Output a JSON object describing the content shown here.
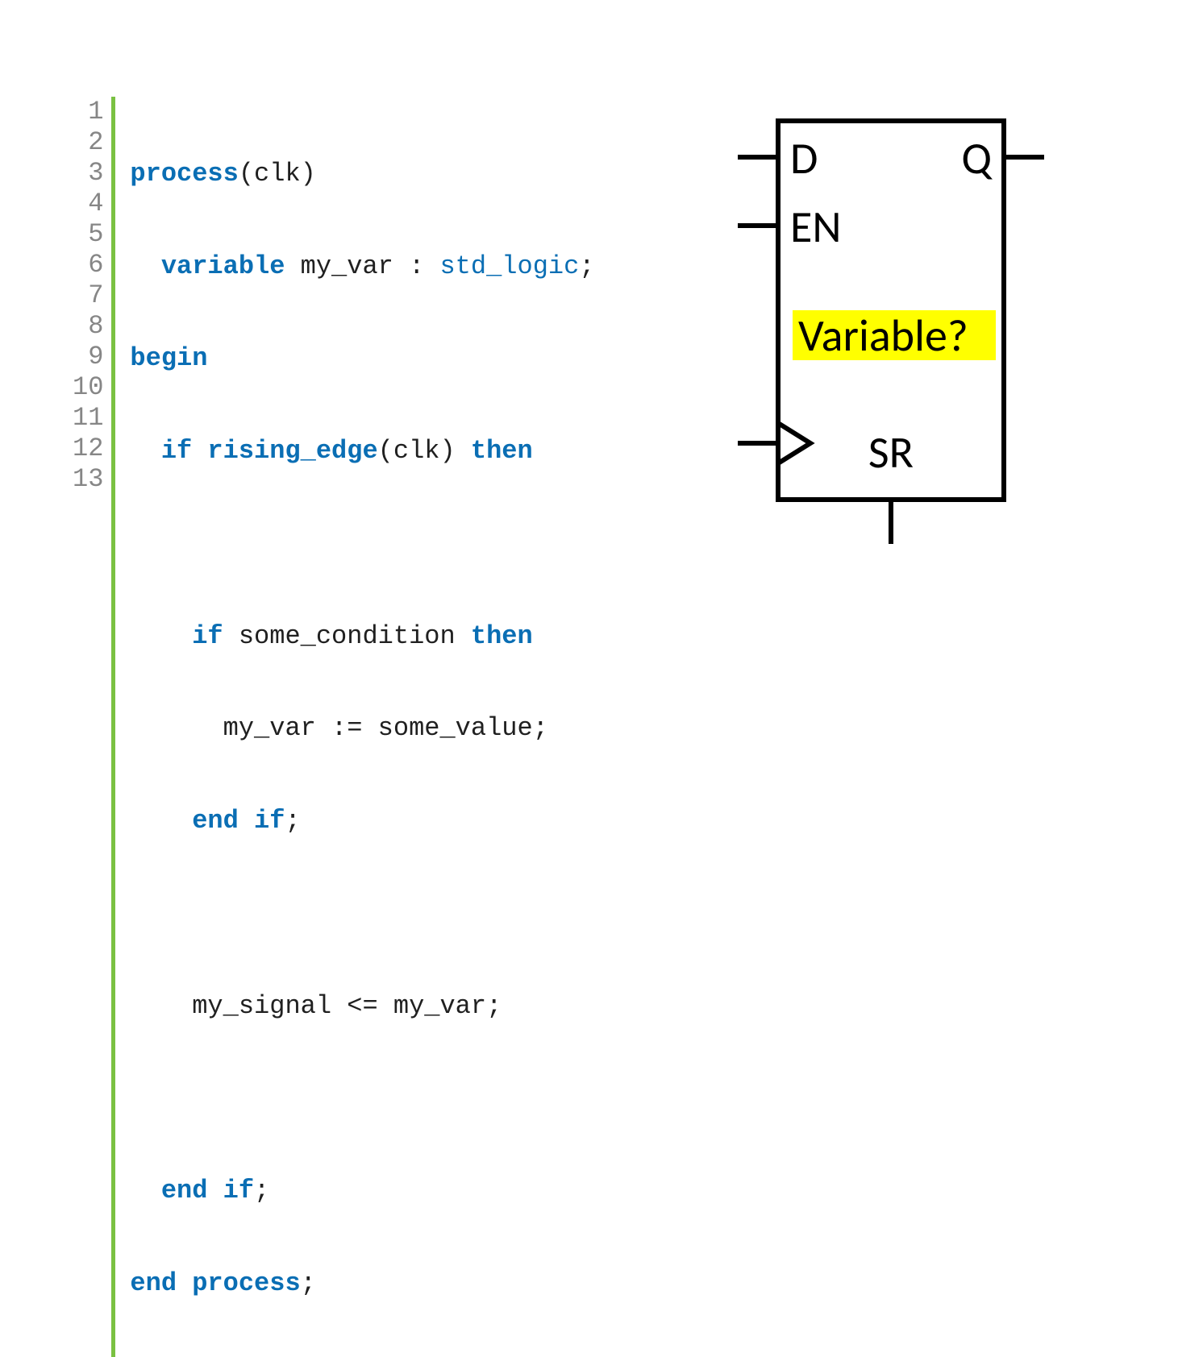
{
  "code": {
    "line_numbers": [
      "1",
      "2",
      "3",
      "4",
      "5",
      "6",
      "7",
      "8",
      "9",
      "10",
      "11",
      "12",
      "13"
    ],
    "line1": {
      "a": "process",
      "b": "(clk)"
    },
    "line2": {
      "a": "  ",
      "b": "variable",
      "c": " my_var : ",
      "d": "std_logic",
      "e": ";"
    },
    "line3": {
      "a": "begin"
    },
    "line4": {
      "a": "  ",
      "b": "if",
      "c": " ",
      "d": "rising_edge",
      "e": "(clk) ",
      "f": "then"
    },
    "line5": {
      "a": ""
    },
    "line6": {
      "a": "    ",
      "b": "if",
      "c": " some_condition ",
      "d": "then"
    },
    "line7": {
      "a": "      my_var := some_value;"
    },
    "line8": {
      "a": "    ",
      "b": "end if",
      "c": ";"
    },
    "line9": {
      "a": ""
    },
    "line10": {
      "a": "    my_signal <= my_var;"
    },
    "line11": {
      "a": ""
    },
    "line12": {
      "a": "  ",
      "b": "end if",
      "c": ";"
    },
    "line13": {
      "a": "",
      "b": "end process",
      "c": ";"
    }
  },
  "diagram": {
    "port_d": "D",
    "port_q": "Q",
    "port_en": "EN",
    "port_sr": "SR",
    "highlight_text": "Variable?"
  }
}
